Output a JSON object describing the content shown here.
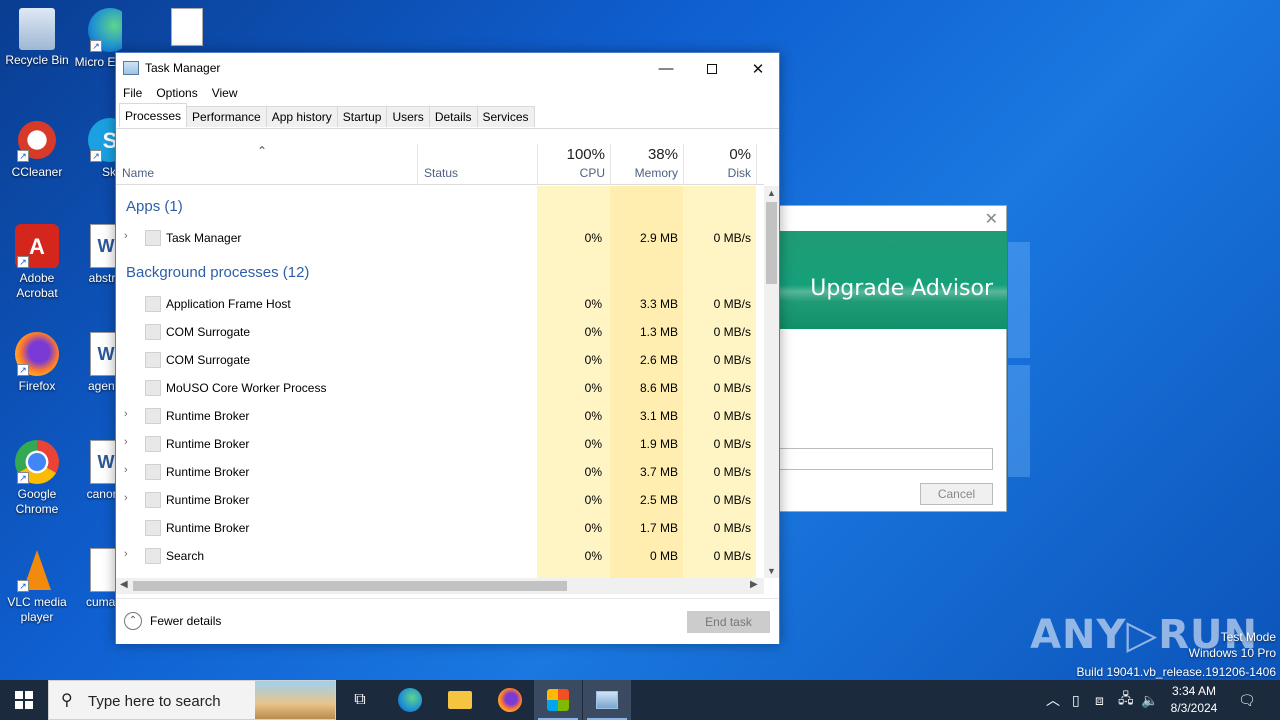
{
  "desktop": {
    "icons": [
      {
        "label": "Recycle Bin",
        "icon": "recycle-bin-icon"
      },
      {
        "label": "Micro Ed",
        "icon": "edge-icon"
      },
      {
        "label": "",
        "icon": "image-file-icon"
      },
      {
        "label": "CCleaner",
        "icon": "ccleaner-icon"
      },
      {
        "label": "Sky",
        "icon": "skype-icon"
      },
      {
        "label": "Adobe Acrobat",
        "icon": "acrobat-icon"
      },
      {
        "label": "abstra",
        "icon": "word-doc-icon"
      },
      {
        "label": "Firefox",
        "icon": "firefox-icon"
      },
      {
        "label": "agentr",
        "icon": "word-doc-icon"
      },
      {
        "label": "Google Chrome",
        "icon": "chrome-icon"
      },
      {
        "label": "canoni",
        "icon": "word-doc-icon"
      },
      {
        "label": "VLC media player",
        "icon": "vlc-icon"
      },
      {
        "label": "cuman",
        "icon": "image-file-icon"
      }
    ]
  },
  "upgrade_advisor": {
    "title": "Upgrade Advisor",
    "cancel_label": "Cancel",
    "progress_fraction": 0.02
  },
  "task_manager": {
    "title": "Task Manager",
    "menu": [
      "File",
      "Options",
      "View"
    ],
    "tabs": [
      "Processes",
      "Performance",
      "App history",
      "Startup",
      "Users",
      "Details",
      "Services"
    ],
    "active_tab": "Processes",
    "columns": {
      "name": "Name",
      "status": "Status",
      "cpu_pct": "100%",
      "cpu": "CPU",
      "memory_pct": "38%",
      "memory": "Memory",
      "disk_pct": "0%",
      "disk": "Disk"
    },
    "groups": [
      {
        "label": "Apps (1)",
        "rows": [
          {
            "name": "Task Manager",
            "expandable": true,
            "cpu": "0%",
            "mem": "2.9 MB",
            "disk": "0 MB/s"
          }
        ]
      },
      {
        "label": "Background processes (12)",
        "rows": [
          {
            "name": "Application Frame Host",
            "expandable": false,
            "cpu": "0%",
            "mem": "3.3 MB",
            "disk": "0 MB/s"
          },
          {
            "name": "COM Surrogate",
            "expandable": false,
            "cpu": "0%",
            "mem": "1.3 MB",
            "disk": "0 MB/s"
          },
          {
            "name": "COM Surrogate",
            "expandable": false,
            "cpu": "0%",
            "mem": "2.6 MB",
            "disk": "0 MB/s"
          },
          {
            "name": "MoUSO Core Worker Process",
            "expandable": false,
            "cpu": "0%",
            "mem": "8.6 MB",
            "disk": "0 MB/s"
          },
          {
            "name": "Runtime Broker",
            "expandable": true,
            "cpu": "0%",
            "mem": "3.1 MB",
            "disk": "0 MB/s"
          },
          {
            "name": "Runtime Broker",
            "expandable": true,
            "cpu": "0%",
            "mem": "1.9 MB",
            "disk": "0 MB/s"
          },
          {
            "name": "Runtime Broker",
            "expandable": true,
            "cpu": "0%",
            "mem": "3.7 MB",
            "disk": "0 MB/s"
          },
          {
            "name": "Runtime Broker",
            "expandable": true,
            "cpu": "0%",
            "mem": "2.5 MB",
            "disk": "0 MB/s"
          },
          {
            "name": "Runtime Broker",
            "expandable": false,
            "cpu": "0%",
            "mem": "1.7 MB",
            "disk": "0 MB/s"
          },
          {
            "name": "Search",
            "expandable": true,
            "cpu": "0%",
            "mem": "0 MB",
            "disk": "0 MB/s"
          }
        ]
      }
    ],
    "fewer_details": "Fewer details",
    "end_task": "End task"
  },
  "watermark": {
    "brand": "ANY RUN",
    "line1": "Test Mode",
    "line2": "Windows 10 Pro",
    "line3": "Build 19041.vb_release.191206-1406"
  },
  "taskbar": {
    "search_placeholder": "Type here to search",
    "time": "3:34 AM",
    "date": "8/3/2024"
  }
}
